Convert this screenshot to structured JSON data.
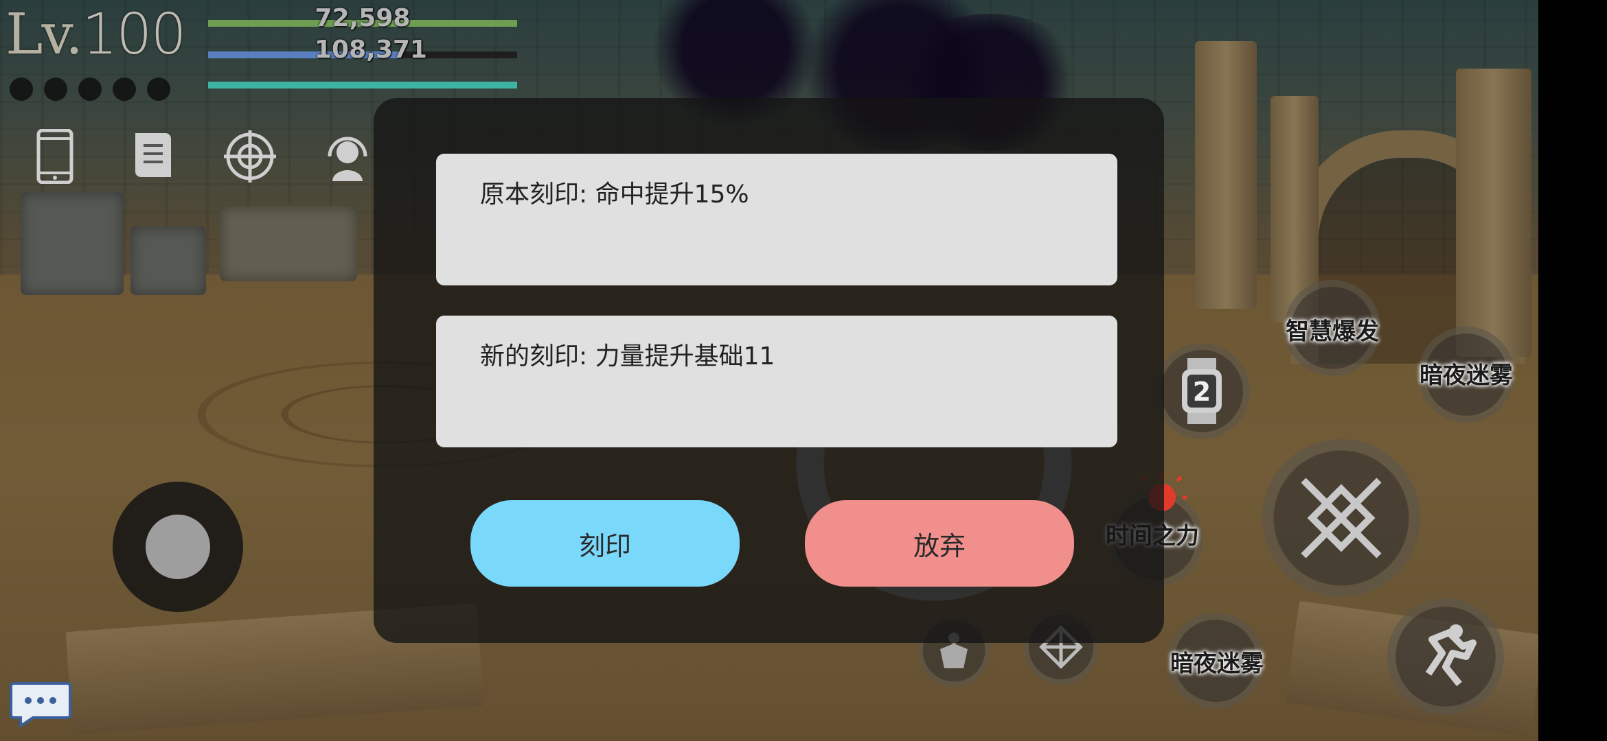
{
  "hud": {
    "level_prefix": "Lv.",
    "level_value": "100",
    "hp_value": "72,598",
    "mp_value": "108,371",
    "hp_fill": 1.0,
    "mp_fill": 0.62,
    "xp_fill": 1.0,
    "colors": {
      "hp": "#6d9e52",
      "mp": "#5a7fbf",
      "xp": "#3fb3a1"
    },
    "buff_slots": 5,
    "icons": [
      "phone-icon",
      "scroll-icon",
      "crosshair-icon",
      "headset-icon"
    ]
  },
  "dialog": {
    "original_label": "原本刻印: 命中提升15%",
    "new_label": "新的刻印: 力量提升基础11",
    "engrave_button": "刻印",
    "discard_button": "放弃",
    "colors": {
      "engrave": "#7ad8fb",
      "discard": "#f08f8c"
    }
  },
  "skills": {
    "wisdom_burst": "智慧爆发",
    "night_mist_top": "暗夜迷雾",
    "time_power": "时间之力",
    "night_mist_bottom": "暗夜迷雾",
    "watch_count": "2"
  }
}
